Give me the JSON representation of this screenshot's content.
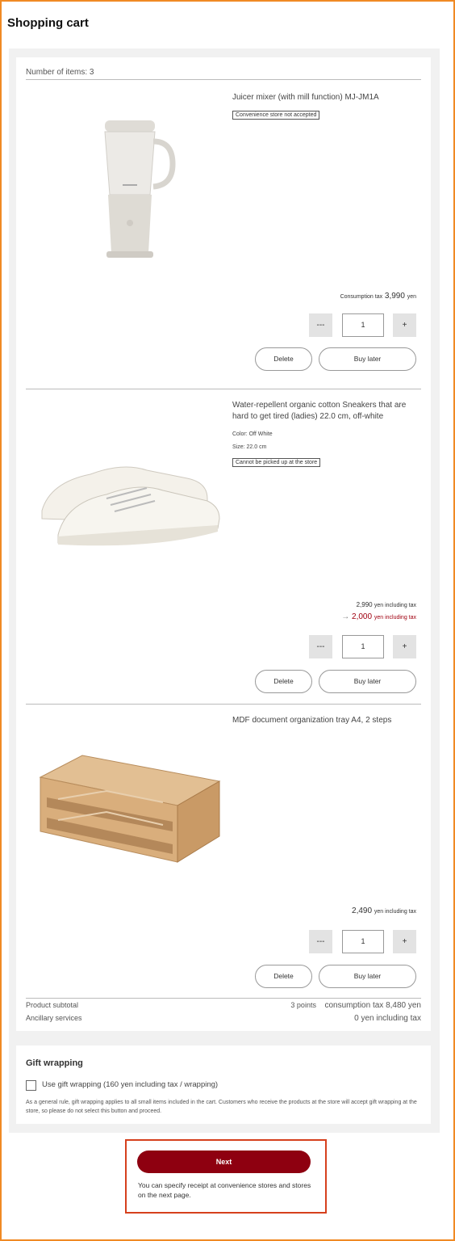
{
  "page": {
    "title": "Shopping cart"
  },
  "cart": {
    "items_count": "Number of items: 3",
    "items": [
      {
        "name": "Juicer mixer (with mill function) MJ-JM1A",
        "tag": "Convenience store not accepted",
        "price_label": "Consumption tax",
        "price": "3,990",
        "price_unit": "yen",
        "qty": "1",
        "minus": "---",
        "plus": "+",
        "delete": "Delete",
        "buy_later": "Buy later",
        "image_icon": "juicer-mixer-image"
      },
      {
        "name": "Water-repellent organic cotton Sneakers that are hard to get tired (ladies) 22.0 cm, off-white",
        "color": "Color: Off White",
        "size": "Size: 22.0 cm",
        "tag": "Cannot be picked up at the store",
        "orig_price": "2,990",
        "orig_unit": "yen including tax",
        "sale_arrow": "→",
        "sale_price": "2,000",
        "sale_unit": "yen including tax",
        "qty": "1",
        "minus": "---",
        "plus": "+",
        "delete": "Delete",
        "buy_later": "Buy later",
        "image_icon": "sneakers-image"
      },
      {
        "name": "MDF document organization tray A4, 2 steps",
        "price": "2,490",
        "price_unit": "yen including tax",
        "qty": "1",
        "minus": "---",
        "plus": "+",
        "delete": "Delete",
        "buy_later": "Buy later",
        "image_icon": "document-tray-image"
      }
    ],
    "summary": {
      "subtotal_label": "Product subtotal",
      "points": "3 points",
      "subtotal_value": "consumption tax 8,480 yen",
      "ancillary_label": "Ancillary services",
      "ancillary_value": "0 yen including tax"
    }
  },
  "gift": {
    "title": "Gift wrapping",
    "checkbox_label": "Use gift wrapping (160 yen including tax / wrapping)",
    "note": "As a general rule, gift wrapping applies to all small items included in the cart. Customers who receive the products at the store will accept gift wrapping at the store, so please do not select this button and proceed."
  },
  "next": {
    "button": "Next",
    "note": "You can specify receipt at convenience stores and stores on the next page."
  },
  "colors": {
    "accent": "#8e0010",
    "sale": "#a00010",
    "highlight_border": "#d6401d",
    "frame": "#f08a24"
  }
}
